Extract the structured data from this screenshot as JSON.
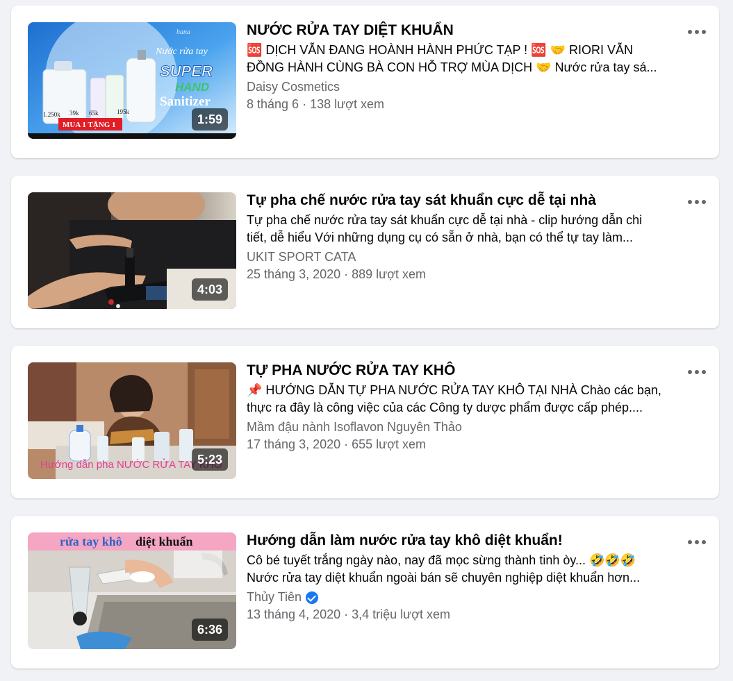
{
  "colors": {
    "background": "#f0f2f5",
    "card": "#ffffff",
    "title": "#050505",
    "secondary_text": "#65676b",
    "verified_badge": "#1877f2"
  },
  "videos": [
    {
      "title": "NƯỚC RỬA TAY DIỆT KHUẨN",
      "description_line1": "🆘 DỊCH VẪN ĐANG HOÀNH HÀNH PHỨC TẠP ! 🆘 🤝 RIORI VẪN",
      "description_line2": "ĐỒNG HÀNH CÙNG BÀ CON HỖ TRỢ MÙA DỊCH 🤝 Nước rửa tay sá...",
      "channel": "Daisy Cosmetics",
      "verified": false,
      "meta": "8 tháng 6 · 138 lượt xem",
      "duration": "1:59",
      "thumbnail_text": {
        "brand": "hana",
        "subtitle": "Nước rửa tay",
        "super": "SUPER",
        "hand": "HAND",
        "sanitizer": "Sanitizer",
        "promo": "MUA 1 TẶNG 1",
        "prices": [
          "1.250k",
          "39k",
          "65k",
          "195k"
        ]
      }
    },
    {
      "title": "Tự pha chế nước rửa tay sát khuẩn cực dễ tại nhà",
      "description_line1": "Tự pha chế nước rửa tay sát khuẩn cực dễ tại nhà - clip hướng dẫn chi",
      "description_line2": "tiết, dễ hiểu Với những dụng cụ có sẵn ở nhà, bạn có thể tự tay làm...",
      "channel": "UKIT SPORT CATA",
      "verified": false,
      "meta": "25 tháng 3, 2020 · 889 lượt xem",
      "duration": "4:03"
    },
    {
      "title": "TỰ PHA NƯỚC RỬA TAY KHÔ",
      "description_line1": "📌 HƯỚNG DẪN TỰ PHA NƯỚC RỬA TAY KHÔ TẠI NHÀ Chào các bạn,",
      "description_line2": "thực ra đây là công việc của các Công ty dược phẩm được cấp phép....",
      "channel": "Mầm đậu nành Isoflavon Nguyên Thảo",
      "verified": false,
      "meta": "17 tháng 3, 2020 · 655 lượt xem",
      "duration": "5:23",
      "thumbnail_text": {
        "caption": "Hướng dẫn pha NƯỚC RỬA TAY KHÔ"
      }
    },
    {
      "title": "Hướng dẫn làm nước rửa tay khô diệt khuẩn!",
      "description_line1": "Cô bé tuyết trắng ngày nào, nay đã mọc sừng thành tinh òy... 🤣🤣🤣",
      "description_line2": "Nước rửa tay diệt khuẩn ngoài bán sẽ chuyên nghiệp diệt khuẩn hơn...",
      "channel": "Thủy Tiên",
      "verified": true,
      "meta": "13 tháng 4, 2020 · 3,4 triệu lượt xem",
      "duration": "6:36",
      "thumbnail_text": {
        "caption_blue": "rửa tay khô",
        "caption_black": "diệt khuẩn"
      }
    }
  ]
}
